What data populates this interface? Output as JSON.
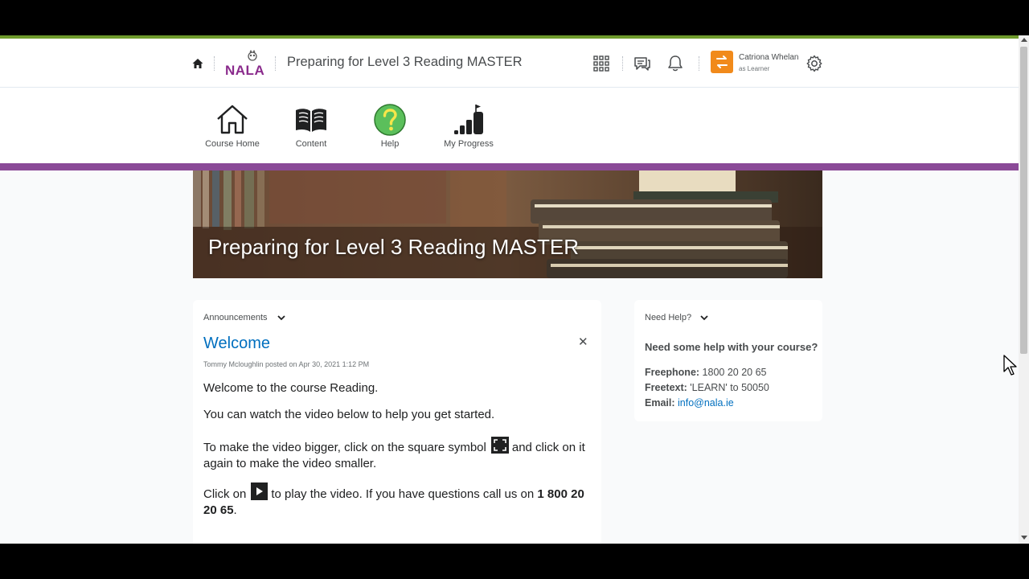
{
  "header": {
    "logo_text": "NALA",
    "course_title": "Preparing for Level 3 Reading MASTER",
    "user_name": "Catriona Whelan",
    "user_role": "as Learner",
    "icons": [
      "home-icon",
      "apps-grid-icon",
      "message-alerts-icon",
      "notification-bell-icon",
      "role-switch-icon",
      "settings-gear-icon"
    ],
    "user_tile_color": "#f18a1b"
  },
  "nav": {
    "items": [
      {
        "label": "Course Home",
        "icon": "house-icon"
      },
      {
        "label": "Content",
        "icon": "open-book-icon"
      },
      {
        "label": "Help",
        "icon": "question-circle-icon"
      },
      {
        "label": "My Progress",
        "icon": "progress-bars-flag-icon"
      }
    ]
  },
  "banner": {
    "title": "Preparing for Level 3 Reading MASTER"
  },
  "announcements": {
    "widget_title": "Announcements",
    "title": "Welcome",
    "meta": "Tommy Mcloughlin posted on Apr 30, 2021 1:12 PM",
    "p1": "Welcome to the course Reading.",
    "p2": "You can watch the video below to help you get started.",
    "p3_before": "To make the video bigger, click on the square symbol",
    "p3_after": "and click on it again to make the video smaller.",
    "p4_before": "Click on",
    "p4_after": "to play the video. If you have questions call us on",
    "p4_phone": "1 800 20 20 65",
    "p4_end": "."
  },
  "need_help": {
    "widget_title": "Need Help?",
    "question": "Need some help with your course?",
    "freephone_label": "Freephone:",
    "freephone_value": "1800 20 20 65",
    "freetext_label": "Freetext:",
    "freetext_value": "'LEARN' to 50050",
    "email_label": "Email:",
    "email_value": "info@nala.ie"
  },
  "colors": {
    "accent_purple": "#8a4a97",
    "top_line_green": "#6e9a2c",
    "link_blue": "#006fbf",
    "help_green": "#5bbf5b"
  }
}
